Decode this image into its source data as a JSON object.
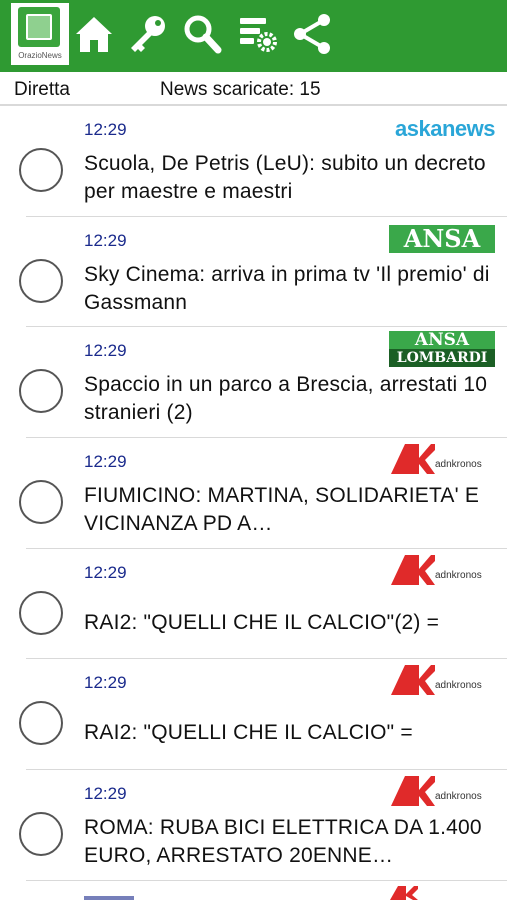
{
  "toolbar": {
    "logo_text": "OrazioNews",
    "icons": [
      "home-icon",
      "key-icon",
      "search-icon",
      "settings-icon",
      "share-icon"
    ],
    "color": "#2f9a32"
  },
  "status": {
    "mode": "Diretta",
    "downloaded": "News scaricate: 15"
  },
  "news": [
    {
      "time": "12:29",
      "source": "askanews",
      "source_text": "askanews",
      "title": "Scuola, De Petris (LeU): subito un decreto per maestre e maestri"
    },
    {
      "time": "12:29",
      "source": "ansa",
      "source_text": "ANSA",
      "title": "Sky Cinema: arriva in prima tv 'Il premio' di Gassmann"
    },
    {
      "time": "12:29",
      "source": "ansa-lombardia",
      "source_text": "ANSA",
      "source_sub": "LOMBARDI",
      "title": "Spaccio in un parco a Brescia, arrestati 10 stranieri (2)"
    },
    {
      "time": "12:29",
      "source": "adnkronos",
      "source_text": "adnkronos",
      "title": "FIUMICINO: MARTINA, SOLIDARIETA' E VICINANZA PD A…"
    },
    {
      "time": "12:29",
      "source": "adnkronos",
      "source_text": "adnkronos",
      "title": "RAI2: \"QUELLI CHE IL CALCIO\"(2) ="
    },
    {
      "time": "12:29",
      "source": "adnkronos",
      "source_text": "adnkronos",
      "title": "RAI2: \"QUELLI CHE IL CALCIO\" ="
    },
    {
      "time": "12:29",
      "source": "adnkronos",
      "source_text": "adnkronos",
      "title": "ROMA: RUBA BICI ELETTRICA DA 1.400 EURO, ARRESTATO 20ENNE…"
    }
  ]
}
